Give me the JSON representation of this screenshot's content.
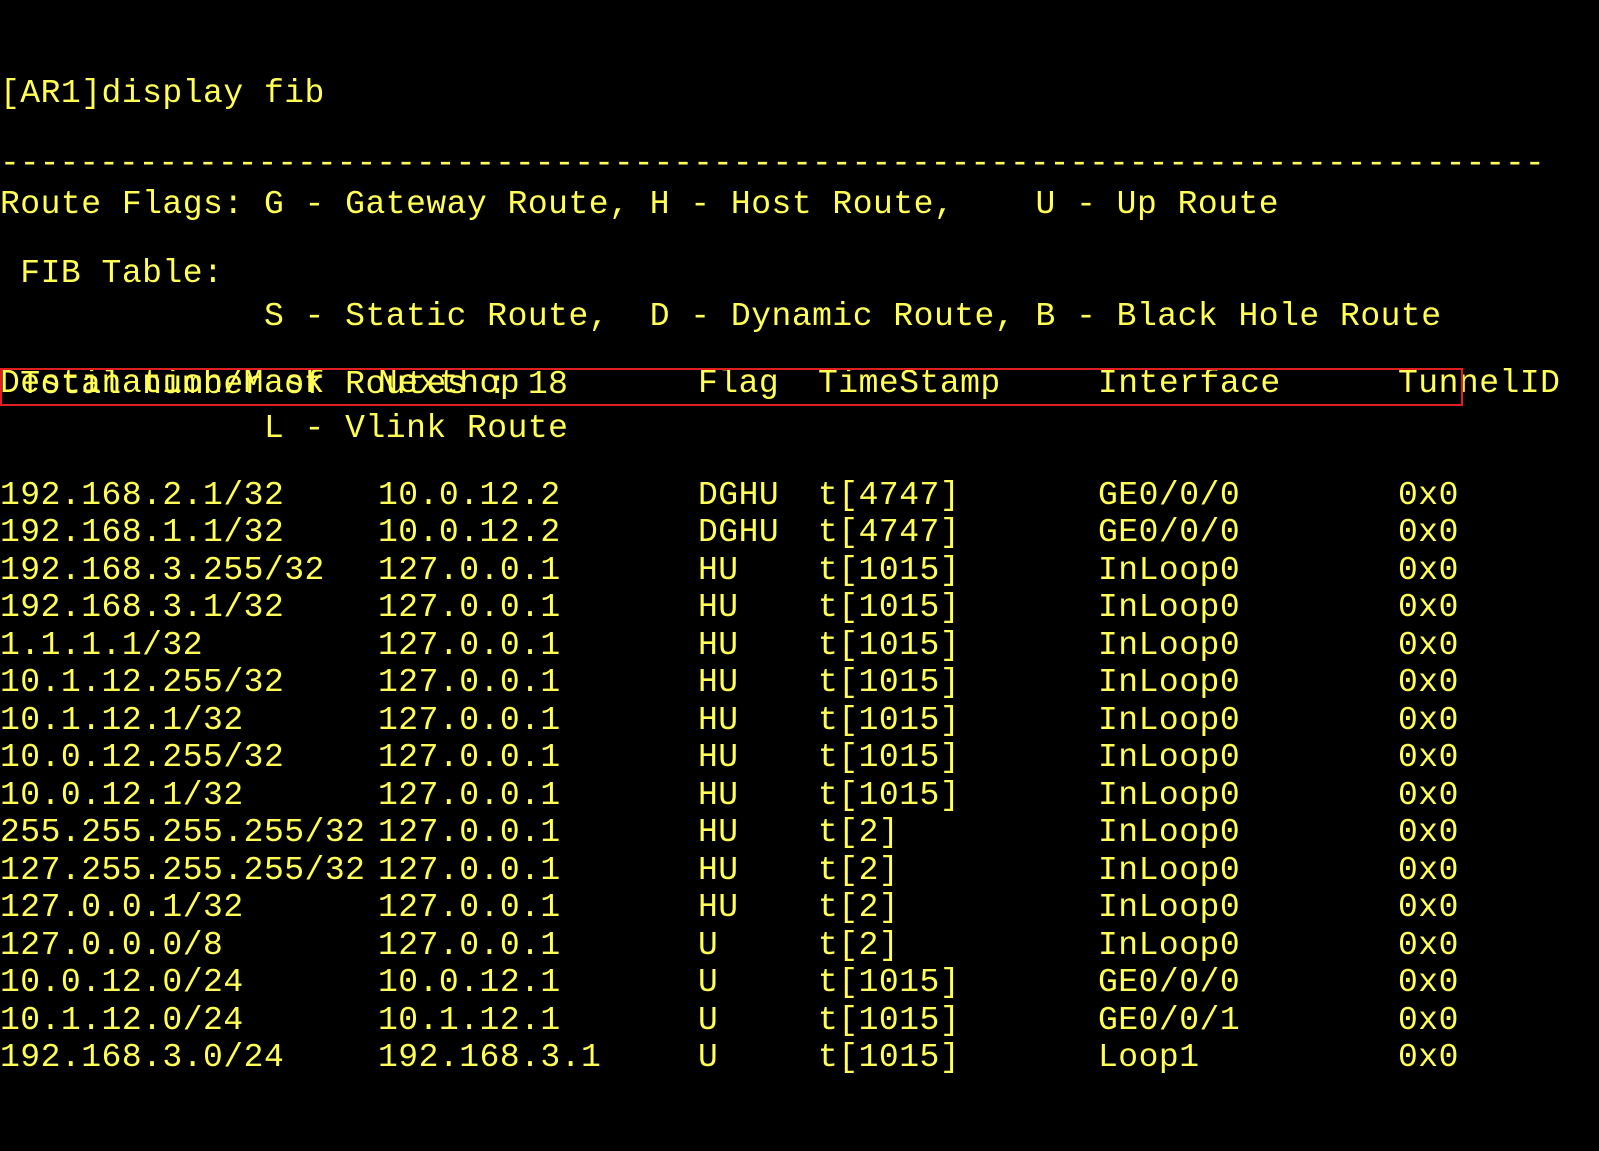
{
  "terminal": {
    "prompt": "[AR1]display fib",
    "flags_lines": [
      "Route Flags: G - Gateway Route, H - Host Route,    U - Up Route",
      "             S - Static Route,  D - Dynamic Route, B - Black Hole Route",
      "             L - Vlink Route"
    ],
    "divider": "------------------------------------------------------------------------------",
    "fib_title": " FIB Table:",
    "total_routes": " Total number of Routes : 18",
    "headers": {
      "destination": "Destination/Mask",
      "nexthop": "Nexthop",
      "flag": "Flag",
      "timestamp": "TimeStamp",
      "interface": "Interface",
      "tunnel": "TunnelID"
    },
    "rows": [
      {
        "dest": "192.168.2.1/32",
        "next": "10.0.12.2",
        "flag": "DGHU",
        "time": "t[4747]",
        "intf": "GE0/0/0",
        "tun": "0x0"
      },
      {
        "dest": "192.168.1.1/32",
        "next": "10.0.12.2",
        "flag": "DGHU",
        "time": "t[4747]",
        "intf": "GE0/0/0",
        "tun": "0x0"
      },
      {
        "dest": "192.168.3.255/32",
        "next": "127.0.0.1",
        "flag": "HU",
        "time": "t[1015]",
        "intf": "InLoop0",
        "tun": "0x0"
      },
      {
        "dest": "192.168.3.1/32",
        "next": "127.0.0.1",
        "flag": "HU",
        "time": "t[1015]",
        "intf": "InLoop0",
        "tun": "0x0"
      },
      {
        "dest": "1.1.1.1/32",
        "next": "127.0.0.1",
        "flag": "HU",
        "time": "t[1015]",
        "intf": "InLoop0",
        "tun": "0x0"
      },
      {
        "dest": "10.1.12.255/32",
        "next": "127.0.0.1",
        "flag": "HU",
        "time": "t[1015]",
        "intf": "InLoop0",
        "tun": "0x0"
      },
      {
        "dest": "10.1.12.1/32",
        "next": "127.0.0.1",
        "flag": "HU",
        "time": "t[1015]",
        "intf": "InLoop0",
        "tun": "0x0"
      },
      {
        "dest": "10.0.12.255/32",
        "next": "127.0.0.1",
        "flag": "HU",
        "time": "t[1015]",
        "intf": "InLoop0",
        "tun": "0x0"
      },
      {
        "dest": "10.0.12.1/32",
        "next": "127.0.0.1",
        "flag": "HU",
        "time": "t[1015]",
        "intf": "InLoop0",
        "tun": "0x0"
      },
      {
        "dest": "255.255.255.255/32",
        "next": "127.0.0.1",
        "flag": "HU",
        "time": "t[2]",
        "intf": "InLoop0",
        "tun": "0x0"
      },
      {
        "dest": "127.255.255.255/32",
        "next": "127.0.0.1",
        "flag": "HU",
        "time": "t[2]",
        "intf": "InLoop0",
        "tun": "0x0"
      },
      {
        "dest": "127.0.0.1/32",
        "next": "127.0.0.1",
        "flag": "HU",
        "time": "t[2]",
        "intf": "InLoop0",
        "tun": "0x0"
      },
      {
        "dest": "127.0.0.0/8",
        "next": "127.0.0.1",
        "flag": "U",
        "time": "t[2]",
        "intf": "InLoop0",
        "tun": "0x0"
      },
      {
        "dest": "10.0.12.0/24",
        "next": "10.0.12.1",
        "flag": "U",
        "time": "t[1015]",
        "intf": "GE0/0/0",
        "tun": "0x0"
      },
      {
        "dest": "10.1.12.0/24",
        "next": "10.1.12.1",
        "flag": "U",
        "time": "t[1015]",
        "intf": "GE0/0/1",
        "tun": "0x0"
      },
      {
        "dest": "192.168.3.0/24",
        "next": "192.168.3.1",
        "flag": "U",
        "time": "t[1015]",
        "intf": "Loop1",
        "tun": "0x0"
      }
    ]
  },
  "colors": {
    "background": "#000000",
    "text": "#ffff55",
    "highlight_box": "#e02020"
  }
}
